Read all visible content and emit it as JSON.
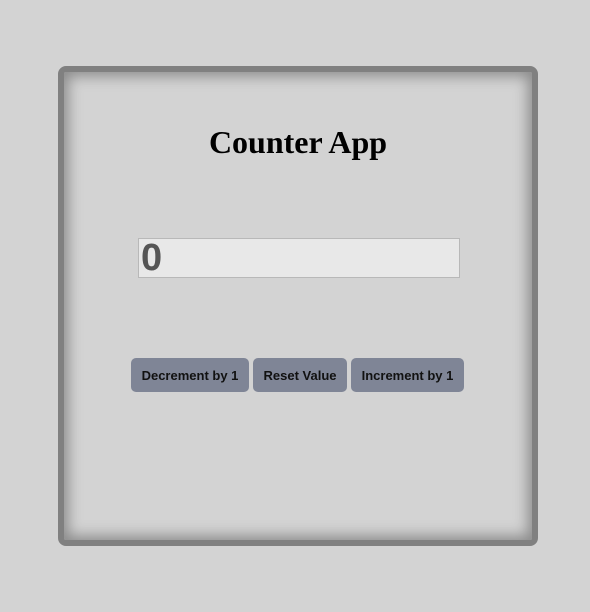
{
  "app": {
    "title": "Counter App",
    "value": "0"
  },
  "buttons": {
    "decrement": "Decrement by 1",
    "reset": "Reset Value",
    "increment": "Increment by 1"
  },
  "colors": {
    "background": "#d3d3d3",
    "border": "#808080",
    "button": "#7f8596",
    "display": "#e8e8e8"
  }
}
